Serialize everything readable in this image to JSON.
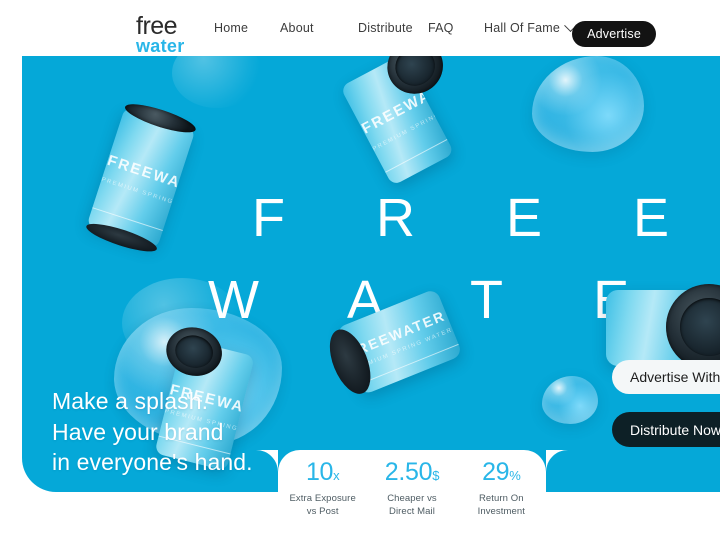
{
  "brand": {
    "logo_line1": "free",
    "logo_line2": "water",
    "accent_color": "#29b6e8",
    "hero_color": "#05a8d8",
    "dark_color": "#0d2026"
  },
  "nav": {
    "links": [
      {
        "label": "Home",
        "name": "nav-link-home"
      },
      {
        "label": "About",
        "name": "nav-link-about"
      },
      {
        "label": "Distribute",
        "name": "nav-link-distribute"
      },
      {
        "label": "FAQ",
        "name": "nav-link-faq"
      },
      {
        "label": "Hall Of Fame",
        "name": "nav-link-hall-of-fame"
      }
    ],
    "dropdown_icon": "chevron-down-icon",
    "cta_label": "Advertise"
  },
  "hero": {
    "wordmark_line1": "F R E E",
    "wordmark_line2": "W A T E R",
    "headline_line1": "Make a splash.",
    "headline_line2": "Have your brand",
    "headline_line3": "in everyone's hand.",
    "cta_primary": "Advertise With Us",
    "cta_secondary": "Distribute Now"
  },
  "can_art": {
    "brand_text": "FREEWATER",
    "sub_text": "PREMIUM SPRING WATER"
  },
  "stats": [
    {
      "value": "10",
      "unit": "x",
      "label_line1": "Extra Exposure",
      "label_line2": "vs Post"
    },
    {
      "value": "2.50",
      "unit": "$",
      "label_line1": "Cheaper vs",
      "label_line2": "Direct Mail"
    },
    {
      "value": "29",
      "unit": "%",
      "label_line1": "Return On",
      "label_line2": "Investment"
    }
  ]
}
